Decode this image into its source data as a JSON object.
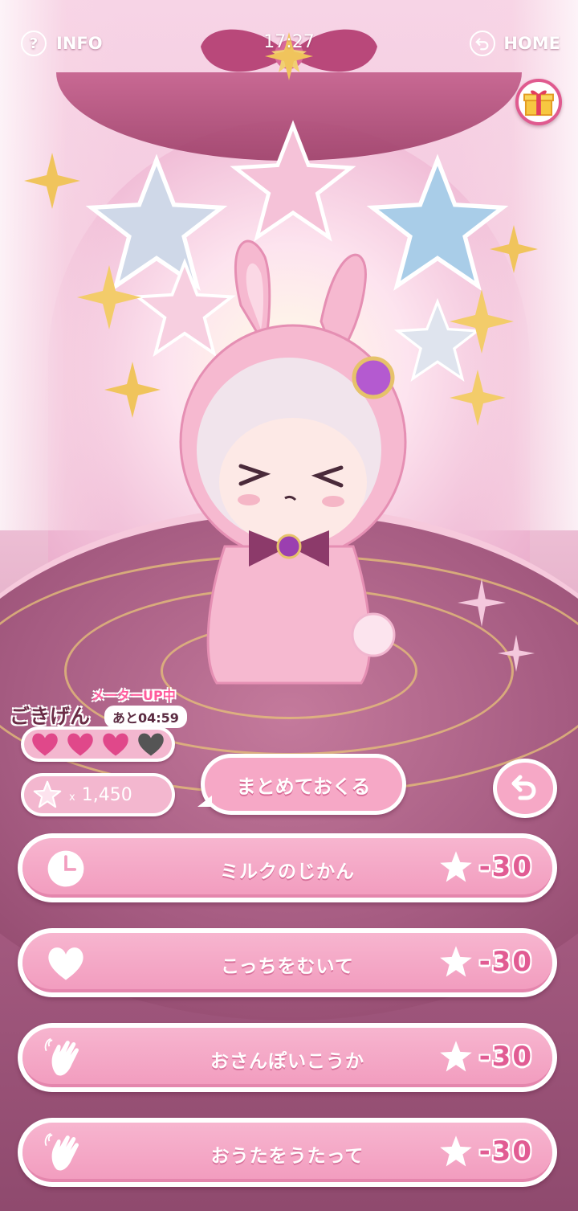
{
  "topbar": {
    "info_label": "INFO",
    "time": "17:27",
    "home_label": "HOME"
  },
  "status": {
    "meter_up": "メーターUP中",
    "mood_label": "ごきげん",
    "mood_timer": "あと04:59",
    "hearts_filled": 3,
    "hearts_total": 4,
    "star_count_prefix": "x",
    "star_count": "1,450"
  },
  "send_all": {
    "label": "まとめておくる"
  },
  "actions": [
    {
      "label": "ミルクのじかん",
      "icon": "clock-icon",
      "cost": "-30"
    },
    {
      "label": "こっちをむいて",
      "icon": "heart-icon",
      "cost": "-30"
    },
    {
      "label": "おさんぽいこうか",
      "icon": "hand-wave-icon",
      "cost": "-30"
    },
    {
      "label": "おうたをうたって",
      "icon": "hand-wave-icon",
      "cost": "-30"
    }
  ],
  "colors": {
    "accent_pink": "#f29dbf",
    "cost_pink": "#e15c93",
    "heart_filled": "#e0488a",
    "heart_empty": "#555555"
  }
}
